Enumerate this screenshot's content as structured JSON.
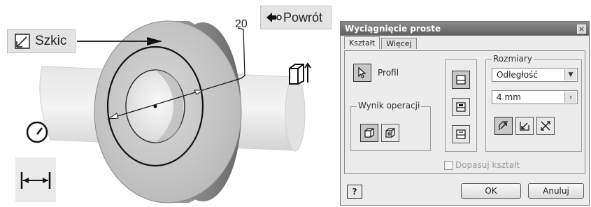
{
  "viewport": {
    "sketch_button_label": "Szkic",
    "return_button_label": "Powrót",
    "dimension_value": "20"
  },
  "dialog": {
    "title": "Wyciągnięcie proste",
    "close_glyph": "×",
    "tabs": [
      {
        "label": "Kształt",
        "active": true
      },
      {
        "label": "Więcej",
        "active": false
      }
    ],
    "profile_label": "Profil",
    "operation_group_title": "Wynik operacji",
    "dimensions_group_title": "Rozmiary",
    "extent_select": "Odległość",
    "distance_value": "4 mm",
    "match_shape_label": "Dopasuj kształt",
    "help_glyph": "?",
    "ok_label": "OK",
    "cancel_label": "Anuluj"
  },
  "icons": {
    "sketch": "sketch-icon",
    "return": "return-arrow-icon",
    "extrude_view": "extrude-direction-icon",
    "measure": "gauge-icon",
    "dimension": "dimension-icon",
    "profile": "cursor-arrow-icon"
  }
}
